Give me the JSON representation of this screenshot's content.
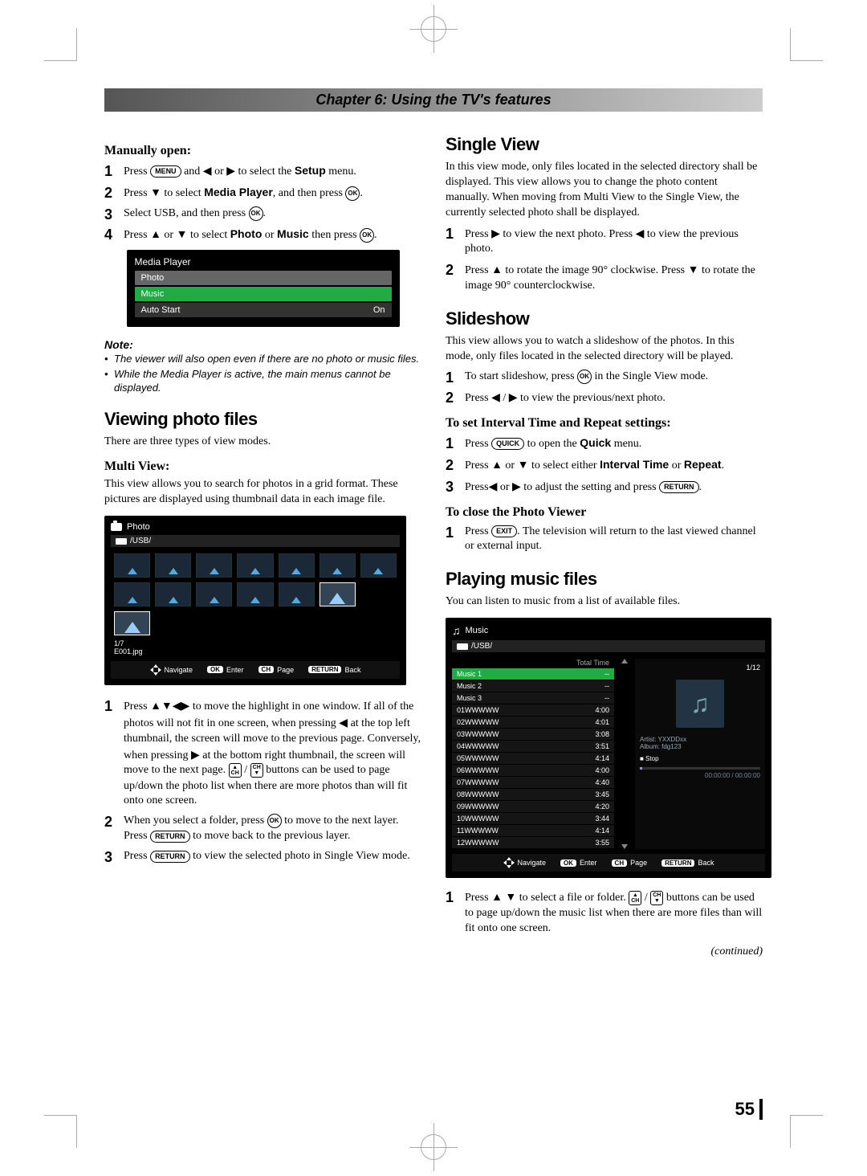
{
  "chapter_title": "Chapter 6: Using the TV's features",
  "page_number": "55",
  "continued": "(continued)",
  "left": {
    "manually_open_heading": "Manually open:",
    "steps_open": [
      {
        "pre": "Press ",
        "btn": "MENU",
        "mid": " and ",
        "a1": "◀",
        "or": " or ",
        "a2": "▶",
        "post": " to select the ",
        "bold": "Setup",
        "post2": " menu."
      },
      {
        "pre": "Press ",
        "a1": "▼",
        "mid": " to select ",
        "bold": "Media Player",
        "mid2": ", and then press ",
        "btn": "OK",
        "post": "."
      },
      {
        "pre": "Select USB, and then press ",
        "btn": "OK",
        "post": "."
      },
      {
        "pre": "Press ",
        "a1": "▲",
        "or": " or ",
        "a2": "▼",
        "mid": " to select ",
        "bold": "Photo",
        "or2": " or ",
        "bold2": "Music",
        "mid2": " then press ",
        "btn": "OK",
        "post": "."
      }
    ],
    "menu": {
      "title": "Media Player",
      "row1": "Photo",
      "row2": "Music",
      "row3_label": "Auto Start",
      "row3_value": "On"
    },
    "note_label": "Note:",
    "notes": [
      "The viewer will also open even if there are no photo or music files.",
      "While the Media Player is active, the main menus cannot be displayed."
    ],
    "viewing_heading": "Viewing photo files",
    "viewing_intro": "There are three types of view modes.",
    "multiview_heading": "Multi View:",
    "multiview_body": "This view allows you to search for photos in a grid format. These pictures are displayed using thumbnail data in each image file.",
    "photo_box": {
      "title": "Photo",
      "path": "/USB/",
      "count": "1/7",
      "filename": "E001.jpg",
      "footer": [
        "Navigate",
        "Enter",
        "Page",
        "Back"
      ],
      "footer_keys": [
        "",
        "OK",
        "CH",
        "RETURN"
      ]
    },
    "multi_steps": [
      "Press ▲▼◀▶ to move the highlight in one window. If all of the photos will not fit in one screen, when pressing ◀ at the top left thumbnail, the screen will move to the previous page. Conversely, when pressing ▶ at the bottom right thumbnail, the screen will move to the next page. CH▲ / CH▼ buttons can be used to page up/down the photo list when there are more photos than will fit onto one screen.",
      "When you select a folder, press OK to move to the next layer. Press RETURN to move back to the previous layer.",
      "Press RETURN to view the selected photo in Single View mode."
    ]
  },
  "right": {
    "single_heading": "Single View",
    "single_body": "In this view mode, only files located in the selected directory shall be displayed. This view allows you to change the photo content manually. When moving from Multi View to the Single View, the currently selected photo shall be displayed.",
    "single_steps": [
      "Press ▶ to view the next photo. Press ◀ to view the previous photo.",
      "Press ▲ to rotate the image 90° clockwise. Press ▼ to rotate the image 90° counterclockwise."
    ],
    "slideshow_heading": "Slideshow",
    "slideshow_body": "This view allows you to watch a slideshow of the photos. In this mode, only files located in the selected directory will be played.",
    "slideshow_steps": [
      "To start slideshow, press OK in the Single View mode.",
      "Press ◀ / ▶ to view the previous/next photo."
    ],
    "interval_heading": "To set Interval Time and Repeat settings:",
    "interval_steps": [
      {
        "pre": "Press ",
        "btn": "QUICK",
        "mid": " to open the ",
        "bold": "Quick",
        "post": " menu."
      },
      {
        "pre": "Press ",
        "a1": "▲",
        "or": " or ",
        "a2": "▼",
        "mid": " to select either ",
        "bold": "Interval Time",
        "or2": " or ",
        "bold2": "Repeat",
        "post": "."
      },
      {
        "pre": "Press",
        "a1": "◀",
        "or": " or ",
        "a2": "▶",
        "mid": " to adjust the setting and press ",
        "btn": "RETURN",
        "post": "."
      }
    ],
    "close_heading": "To close the Photo Viewer",
    "close_step": "Press EXIT. The television will return to the last viewed channel or external input.",
    "playing_heading": "Playing music files",
    "playing_intro": "You can listen to music from a list of available files.",
    "music_box": {
      "title": "Music",
      "path": "/USB/",
      "col_total": "Total Time",
      "count": "1/12",
      "rows": [
        {
          "name": "Music 1",
          "val": "--"
        },
        {
          "name": "Music 2",
          "val": "--"
        },
        {
          "name": "Music 3",
          "val": "--"
        },
        {
          "name": "01WWWWW",
          "val": "4:00"
        },
        {
          "name": "02WWWWW",
          "val": "4:01"
        },
        {
          "name": "03WWWWW",
          "val": "3:08"
        },
        {
          "name": "04WWWWW",
          "val": "3:51"
        },
        {
          "name": "05WWWWW",
          "val": "4:14"
        },
        {
          "name": "06WWWWW",
          "val": "4:00"
        },
        {
          "name": "07WWWWW",
          "val": "4:40"
        },
        {
          "name": "08WWWWW",
          "val": "3:45"
        },
        {
          "name": "09WWWWW",
          "val": "4:20"
        },
        {
          "name": "10WWWWW",
          "val": "3:44"
        },
        {
          "name": "11WWWWW",
          "val": "4:14"
        },
        {
          "name": "12WWWWW",
          "val": "3:55"
        }
      ],
      "artist": "Artist: YXXDDxx",
      "album": "Album: fdg123",
      "pause": "■ Stop",
      "time": "00:00:00 / 00:00:00",
      "footer": [
        "Navigate",
        "Enter",
        "Page",
        "Back"
      ],
      "footer_keys": [
        "",
        "OK",
        "CH",
        "RETURN"
      ]
    },
    "music_step": "Press ▲ ▼ to select a file or folder. CH▲ / CH▼ buttons can be used to page up/down the music list when there are more files than will fit onto one screen."
  }
}
